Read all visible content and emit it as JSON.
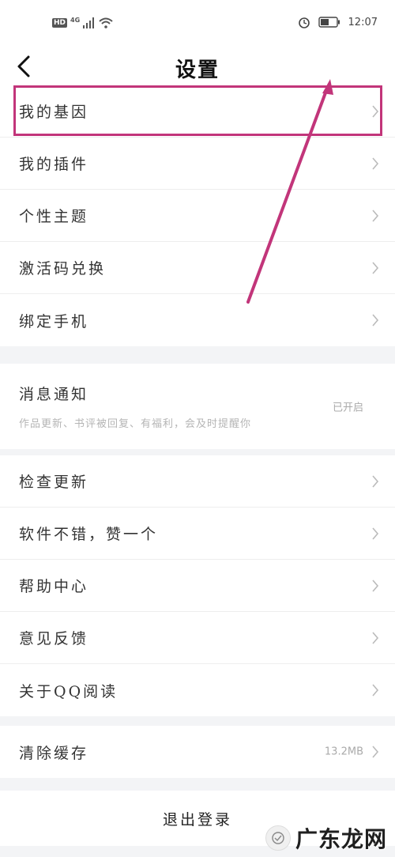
{
  "status_bar": {
    "hd": "HD",
    "network": "4G",
    "time": "12:07"
  },
  "header": {
    "title": "设置"
  },
  "groups": [
    {
      "items": [
        {
          "label": "我的基因"
        },
        {
          "label": "我的插件"
        },
        {
          "label": "个性主题"
        },
        {
          "label": "激活码兑换"
        },
        {
          "label": "绑定手机"
        }
      ]
    },
    {
      "items": [
        {
          "label": "消息通知",
          "subtitle": "作品更新、书评被回复、有福利，会及时提醒你",
          "value": "已开启"
        }
      ]
    },
    {
      "items": [
        {
          "label": "检查更新"
        },
        {
          "label": "软件不错，赞一个"
        },
        {
          "label": "帮助中心"
        },
        {
          "label": "意见反馈"
        },
        {
          "label": "关于QQ阅读"
        }
      ]
    },
    {
      "items": [
        {
          "label": "清除缓存",
          "value": "13.2MB"
        }
      ]
    }
  ],
  "logout": {
    "label": "退出登录"
  },
  "watermark": {
    "text": "广东龙网"
  },
  "colors": {
    "annotation": "#c2357a",
    "background": "#f3f4f6"
  },
  "icons": [
    "back-arrow-icon",
    "chevron-right-icon",
    "alarm-icon",
    "battery-icon",
    "wifi-icon",
    "signal-icon"
  ]
}
